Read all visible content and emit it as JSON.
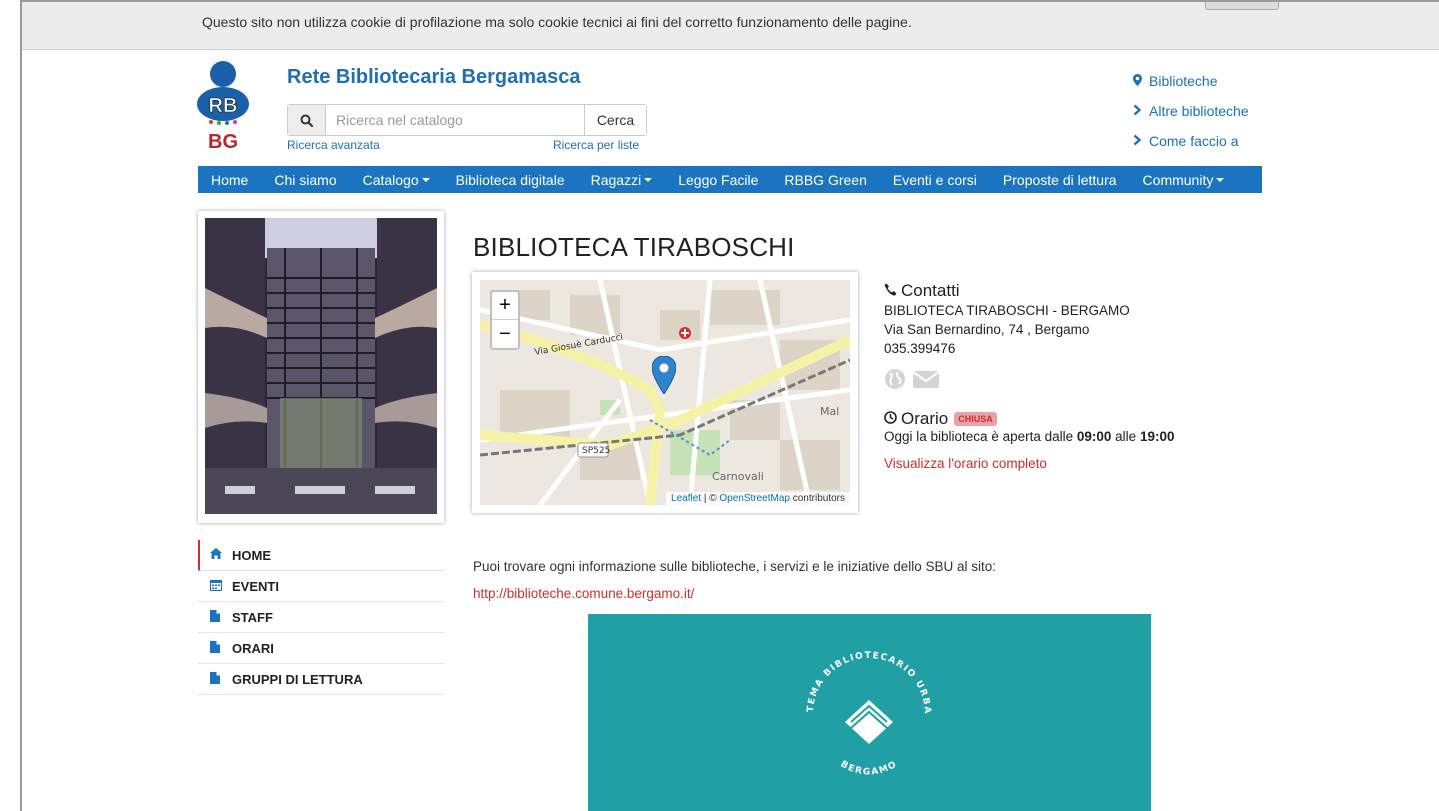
{
  "cookie": {
    "text": "Questo sito non utilizza cookie di profilazione ma solo cookie tecnici ai fini del corretto funzionamento delle pagine."
  },
  "header": {
    "logo_text_top": "RB",
    "logo_text_bottom": "BG",
    "site_title": "Rete Bibliotecaria Bergamasca",
    "search_placeholder": "Ricerca nel catalogo",
    "search_button": "Cerca",
    "advanced_search": "Ricerca avanzata",
    "list_search": "Ricerca per liste",
    "top_links": [
      {
        "label": "Biblioteche",
        "icon": "map-marker-icon"
      },
      {
        "label": "Altre biblioteche",
        "icon": "chevron-right-icon"
      },
      {
        "label": "Come faccio a",
        "icon": "chevron-right-icon"
      }
    ]
  },
  "navbar": {
    "items": [
      {
        "label": "Home",
        "dropdown": false
      },
      {
        "label": "Chi siamo",
        "dropdown": false
      },
      {
        "label": "Catalogo",
        "dropdown": true
      },
      {
        "label": "Biblioteca digitale",
        "dropdown": false
      },
      {
        "label": "Ragazzi",
        "dropdown": true
      },
      {
        "label": "Leggo Facile",
        "dropdown": false
      },
      {
        "label": "RBBG Green",
        "dropdown": false
      },
      {
        "label": "Eventi e corsi",
        "dropdown": false
      },
      {
        "label": "Proposte di lettura",
        "dropdown": false
      },
      {
        "label": "Community",
        "dropdown": true
      }
    ],
    "color": "#1a74c0"
  },
  "sidebar": {
    "items": [
      {
        "label": "HOME",
        "icon": "home-icon",
        "active": true
      },
      {
        "label": "EVENTI",
        "icon": "calendar-icon",
        "active": false
      },
      {
        "label": "STAFF",
        "icon": "file-icon",
        "active": false
      },
      {
        "label": "ORARI",
        "icon": "file-icon",
        "active": false
      },
      {
        "label": "GRUPPI DI LETTURA",
        "icon": "file-icon",
        "active": false
      }
    ]
  },
  "main": {
    "title": "BIBLIOTECA TIRABOSCHI",
    "map": {
      "zoom_in": "+",
      "zoom_out": "−",
      "attribution_leaflet": "Leaflet",
      "attribution_sep": " | © ",
      "attribution_osm": "OpenStreetMap",
      "attribution_tail": " contributors",
      "labels": {
        "street1": "Via Giosuè Carducci",
        "road": "SP525",
        "area": "Carnovali",
        "edge": "Mal"
      }
    },
    "contacts": {
      "heading": "Contatti",
      "name": "BIBLIOTECA TIRABOSCHI - BERGAMO",
      "address": "Via San Bernardino, 74 , Bergamo",
      "phone": "035.399476"
    },
    "orario": {
      "heading": "Orario",
      "badge": "CHIUSA",
      "today_prefix": "Oggi la biblioteca è aperta dalle ",
      "open_time": "09:00",
      "mid": " alle ",
      "close_time": "19:00",
      "full_link": "Visualizza l'orario completo"
    },
    "info_text": "Puoi trovare ogni informazione sulle biblioteche, i servizi e le iniziative dello SBU al sito:",
    "info_link": "http://biblioteche.comune.bergamo.it/",
    "banner": {
      "color": "#20a0a4",
      "top_arc": "SISTEMA BIBLIOTECARIO URBANO",
      "bottom_arc": "BERGAMO"
    }
  }
}
